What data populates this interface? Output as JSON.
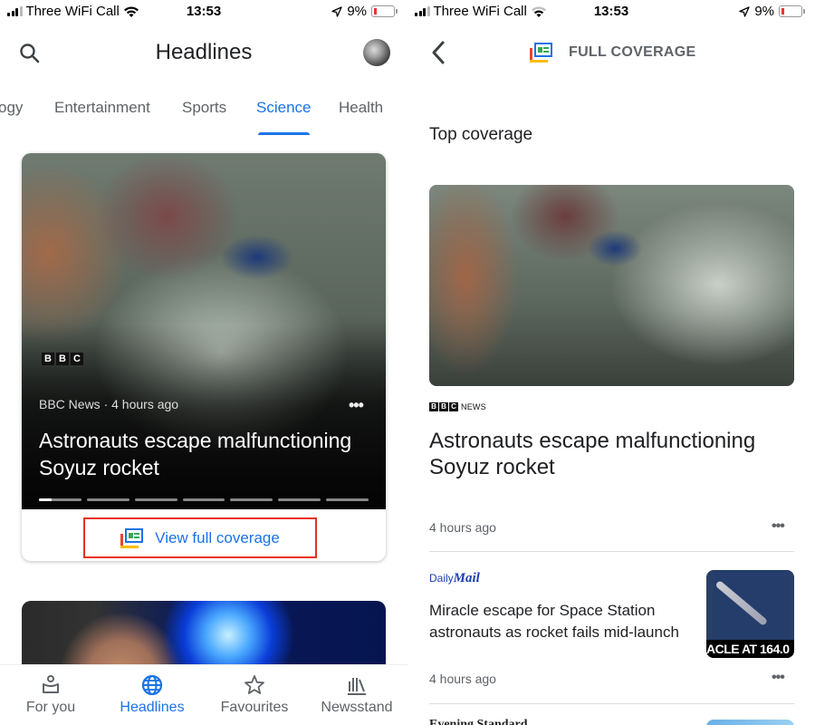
{
  "status_bar": {
    "carrier": "Three WiFi Call",
    "time": "13:53",
    "battery": "9%",
    "battery_level": 0.09
  },
  "left": {
    "header": {
      "title": "Headlines"
    },
    "tabs": [
      {
        "label": "ogy",
        "active": false
      },
      {
        "label": "Entertainment",
        "active": false
      },
      {
        "label": "Sports",
        "active": false
      },
      {
        "label": "Science",
        "active": true
      },
      {
        "label": "Health",
        "active": false
      }
    ],
    "card": {
      "logo": [
        "B",
        "B",
        "C"
      ],
      "meta": "BBC News · 4 hours ago",
      "headline": "Astronauts escape malfunctioning Soyuz rocket",
      "carousel_count": 7,
      "carousel_active": 0,
      "view_full_coverage": "View full coverage"
    },
    "bottom_nav": [
      {
        "label": "For you",
        "icon": "person-icon",
        "active": false
      },
      {
        "label": "Headlines",
        "icon": "globe-icon",
        "active": true
      },
      {
        "label": "Favourites",
        "icon": "star-icon",
        "active": false
      },
      {
        "label": "Newsstand",
        "icon": "newsstand-icon",
        "active": false
      }
    ]
  },
  "right": {
    "header": {
      "title": "FULL COVERAGE"
    },
    "section_title": "Top coverage",
    "top_story": {
      "source_logo": [
        "B",
        "B",
        "C"
      ],
      "source_suffix": "NEWS",
      "headline": "Astronauts escape malfunctioning Soyuz rocket",
      "time": "4 hours ago"
    },
    "story2": {
      "source_prefix": "Daily",
      "source_main": "Mail",
      "headline": "Miracle escape for Space Station astronauts as rocket fails mid-launch",
      "time": "4 hours ago",
      "thumb_caption": "ACLE AT 164.0"
    },
    "story3": {
      "source": "Evening Standard"
    }
  },
  "colors": {
    "accent": "#1a73e8",
    "highlight_box": "#e8301c",
    "text_primary": "#202124",
    "text_secondary": "#5f6368"
  }
}
